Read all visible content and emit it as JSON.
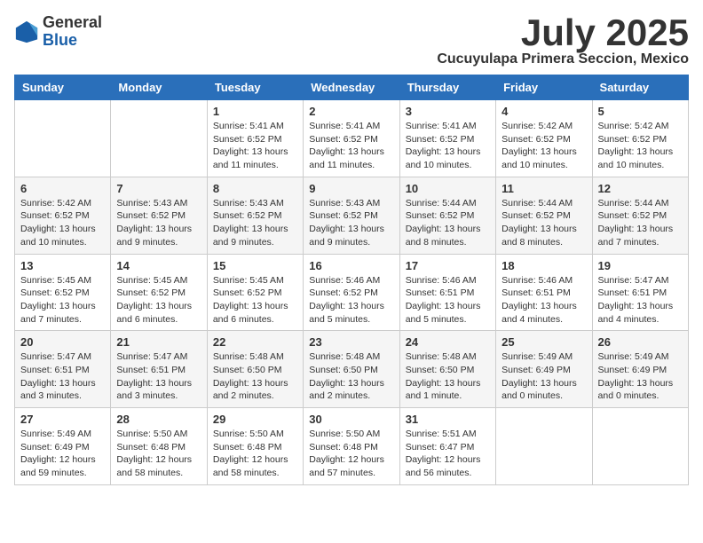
{
  "logo": {
    "general": "General",
    "blue": "Blue"
  },
  "title": "July 2025",
  "location": "Cucuyulapa Primera Seccion, Mexico",
  "days_of_week": [
    "Sunday",
    "Monday",
    "Tuesday",
    "Wednesday",
    "Thursday",
    "Friday",
    "Saturday"
  ],
  "weeks": [
    [
      {
        "day": "",
        "detail": ""
      },
      {
        "day": "",
        "detail": ""
      },
      {
        "day": "1",
        "detail": "Sunrise: 5:41 AM\nSunset: 6:52 PM\nDaylight: 13 hours and 11 minutes."
      },
      {
        "day": "2",
        "detail": "Sunrise: 5:41 AM\nSunset: 6:52 PM\nDaylight: 13 hours and 11 minutes."
      },
      {
        "day": "3",
        "detail": "Sunrise: 5:41 AM\nSunset: 6:52 PM\nDaylight: 13 hours and 10 minutes."
      },
      {
        "day": "4",
        "detail": "Sunrise: 5:42 AM\nSunset: 6:52 PM\nDaylight: 13 hours and 10 minutes."
      },
      {
        "day": "5",
        "detail": "Sunrise: 5:42 AM\nSunset: 6:52 PM\nDaylight: 13 hours and 10 minutes."
      }
    ],
    [
      {
        "day": "6",
        "detail": "Sunrise: 5:42 AM\nSunset: 6:52 PM\nDaylight: 13 hours and 10 minutes."
      },
      {
        "day": "7",
        "detail": "Sunrise: 5:43 AM\nSunset: 6:52 PM\nDaylight: 13 hours and 9 minutes."
      },
      {
        "day": "8",
        "detail": "Sunrise: 5:43 AM\nSunset: 6:52 PM\nDaylight: 13 hours and 9 minutes."
      },
      {
        "day": "9",
        "detail": "Sunrise: 5:43 AM\nSunset: 6:52 PM\nDaylight: 13 hours and 9 minutes."
      },
      {
        "day": "10",
        "detail": "Sunrise: 5:44 AM\nSunset: 6:52 PM\nDaylight: 13 hours and 8 minutes."
      },
      {
        "day": "11",
        "detail": "Sunrise: 5:44 AM\nSunset: 6:52 PM\nDaylight: 13 hours and 8 minutes."
      },
      {
        "day": "12",
        "detail": "Sunrise: 5:44 AM\nSunset: 6:52 PM\nDaylight: 13 hours and 7 minutes."
      }
    ],
    [
      {
        "day": "13",
        "detail": "Sunrise: 5:45 AM\nSunset: 6:52 PM\nDaylight: 13 hours and 7 minutes."
      },
      {
        "day": "14",
        "detail": "Sunrise: 5:45 AM\nSunset: 6:52 PM\nDaylight: 13 hours and 6 minutes."
      },
      {
        "day": "15",
        "detail": "Sunrise: 5:45 AM\nSunset: 6:52 PM\nDaylight: 13 hours and 6 minutes."
      },
      {
        "day": "16",
        "detail": "Sunrise: 5:46 AM\nSunset: 6:52 PM\nDaylight: 13 hours and 5 minutes."
      },
      {
        "day": "17",
        "detail": "Sunrise: 5:46 AM\nSunset: 6:51 PM\nDaylight: 13 hours and 5 minutes."
      },
      {
        "day": "18",
        "detail": "Sunrise: 5:46 AM\nSunset: 6:51 PM\nDaylight: 13 hours and 4 minutes."
      },
      {
        "day": "19",
        "detail": "Sunrise: 5:47 AM\nSunset: 6:51 PM\nDaylight: 13 hours and 4 minutes."
      }
    ],
    [
      {
        "day": "20",
        "detail": "Sunrise: 5:47 AM\nSunset: 6:51 PM\nDaylight: 13 hours and 3 minutes."
      },
      {
        "day": "21",
        "detail": "Sunrise: 5:47 AM\nSunset: 6:51 PM\nDaylight: 13 hours and 3 minutes."
      },
      {
        "day": "22",
        "detail": "Sunrise: 5:48 AM\nSunset: 6:50 PM\nDaylight: 13 hours and 2 minutes."
      },
      {
        "day": "23",
        "detail": "Sunrise: 5:48 AM\nSunset: 6:50 PM\nDaylight: 13 hours and 2 minutes."
      },
      {
        "day": "24",
        "detail": "Sunrise: 5:48 AM\nSunset: 6:50 PM\nDaylight: 13 hours and 1 minute."
      },
      {
        "day": "25",
        "detail": "Sunrise: 5:49 AM\nSunset: 6:49 PM\nDaylight: 13 hours and 0 minutes."
      },
      {
        "day": "26",
        "detail": "Sunrise: 5:49 AM\nSunset: 6:49 PM\nDaylight: 13 hours and 0 minutes."
      }
    ],
    [
      {
        "day": "27",
        "detail": "Sunrise: 5:49 AM\nSunset: 6:49 PM\nDaylight: 12 hours and 59 minutes."
      },
      {
        "day": "28",
        "detail": "Sunrise: 5:50 AM\nSunset: 6:48 PM\nDaylight: 12 hours and 58 minutes."
      },
      {
        "day": "29",
        "detail": "Sunrise: 5:50 AM\nSunset: 6:48 PM\nDaylight: 12 hours and 58 minutes."
      },
      {
        "day": "30",
        "detail": "Sunrise: 5:50 AM\nSunset: 6:48 PM\nDaylight: 12 hours and 57 minutes."
      },
      {
        "day": "31",
        "detail": "Sunrise: 5:51 AM\nSunset: 6:47 PM\nDaylight: 12 hours and 56 minutes."
      },
      {
        "day": "",
        "detail": ""
      },
      {
        "day": "",
        "detail": ""
      }
    ]
  ]
}
